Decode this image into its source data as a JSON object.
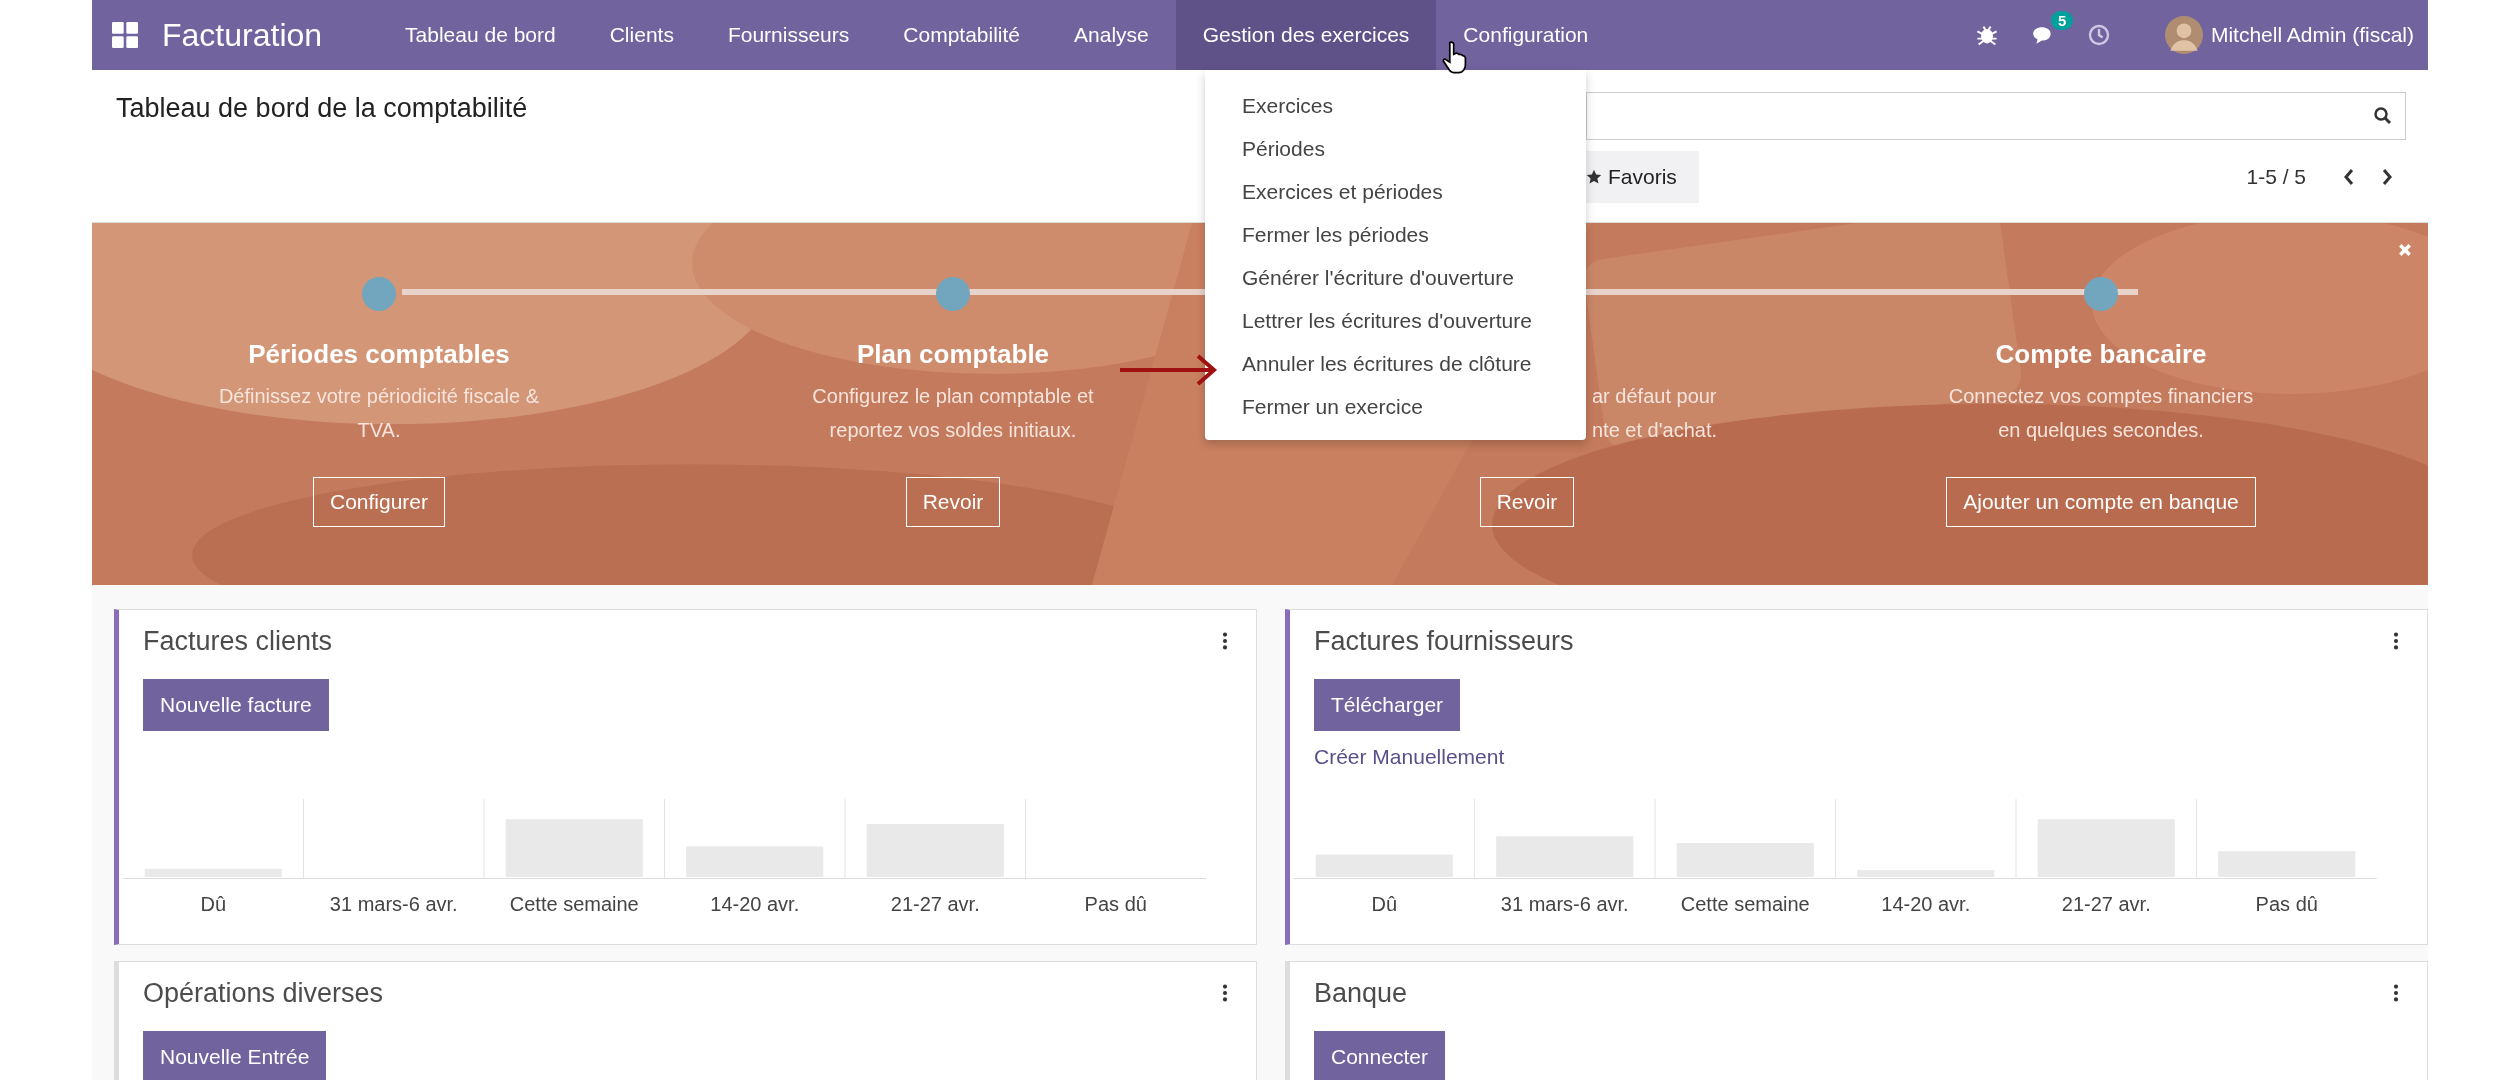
{
  "navbar": {
    "app_title": "Facturation",
    "menu": [
      {
        "label": "Tableau de bord",
        "selected": false
      },
      {
        "label": "Clients",
        "selected": false
      },
      {
        "label": "Fournisseurs",
        "selected": false
      },
      {
        "label": "Comptabilité",
        "selected": false
      },
      {
        "label": "Analyse",
        "selected": false
      },
      {
        "label": "Gestion des exercices",
        "selected": true
      },
      {
        "label": "Configuration",
        "selected": false
      }
    ],
    "notification_count": "5",
    "user": "Mitchell Admin (fiscal)"
  },
  "control_panel": {
    "breadcrumb": "Tableau de bord de la comptabilité",
    "favorites_button": "Favoris",
    "pager": "1-5 / 5"
  },
  "dropdown": {
    "items": [
      "Exercices",
      "Périodes",
      "Exercices et périodes",
      "Fermer les périodes",
      "Générer l'écriture d'ouverture",
      "Lettrer les écritures d'ouverture",
      "Annuler les écritures de clôture",
      "Fermer un exercice"
    ]
  },
  "onboarding": {
    "steps": [
      {
        "title": "Périodes comptables",
        "description": [
          "Définissez votre périodicité fiscale &",
          "TVA."
        ],
        "button": "Configurer"
      },
      {
        "title": "Plan comptable",
        "description": [
          "Configurez le plan comptable et",
          "reportez vos soldes initiaux."
        ],
        "button": "Revoir"
      },
      {
        "description": [
          "ar défaut pour",
          "nte et d'achat."
        ],
        "button": "Revoir"
      },
      {
        "title": "Compte bancaire",
        "description": [
          "Connectez vos comptes financiers",
          "en quelques secondes."
        ],
        "button": "Ajouter un compte en banque"
      }
    ]
  },
  "journals": [
    {
      "title": "Factures clients",
      "highlighted": true,
      "button": "Nouvelle facture",
      "categories": [
        "Dû",
        "31 mars-6 avr.",
        "Cette semaine",
        "14-20 avr.",
        "21-27 avr.",
        "Pas dû"
      ]
    },
    {
      "title": "Factures fournisseurs",
      "highlighted": true,
      "button": "Télécharger",
      "link": "Créer Manuellement",
      "categories": [
        "Dû",
        "31 mars-6 avr.",
        "Cette semaine",
        "14-20 avr.",
        "21-27 avr.",
        "Pas dû"
      ]
    },
    {
      "title": "Opérations diverses",
      "highlighted": false,
      "button": "Nouvelle Entrée"
    },
    {
      "title": "Banque",
      "highlighted": false,
      "button": "Connecter"
    }
  ]
}
